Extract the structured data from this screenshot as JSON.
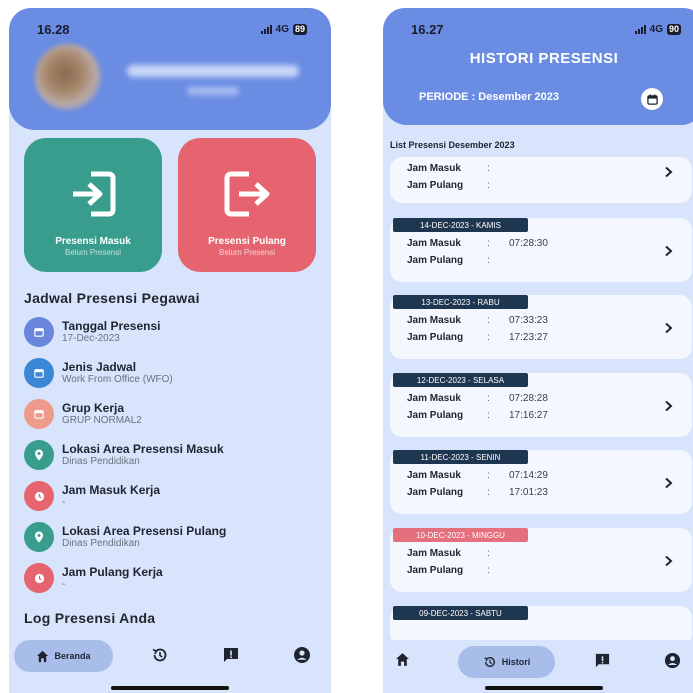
{
  "left": {
    "status": {
      "time": "16.28",
      "network": "4G",
      "battery": "89"
    },
    "tiles": [
      {
        "title": "Presensi Masuk",
        "subtitle": "Belum Presensi",
        "color": "#399d8e"
      },
      {
        "title": "Presensi Pulang",
        "subtitle": "Belum Presensi",
        "color": "#e6646f"
      }
    ],
    "schedule_title": "Jadwal Presensi Pegawai",
    "schedule": [
      {
        "title": "Tanggal Presensi",
        "value": "17-Dec-2023",
        "icon": "calendar-icon",
        "color": "#6a85dc"
      },
      {
        "title": "Jenis Jadwal",
        "value": "Work From Office (WFO)",
        "icon": "calendar-icon",
        "color": "#3b87d6"
      },
      {
        "title": "Grup Kerja",
        "value": "GRUP NORMAL2",
        "icon": "calendar-icon",
        "color": "#ef9b8b"
      },
      {
        "title": "Lokasi Area Presensi Masuk",
        "value": "Dinas Pendidikan",
        "icon": "location-pin-icon",
        "color": "#399d8e"
      },
      {
        "title": "Jam Masuk Kerja",
        "value": "-",
        "icon": "clock-icon",
        "color": "#e6646f"
      },
      {
        "title": "Lokasi Area Presensi Pulang",
        "value": "Dinas Pendidikan",
        "icon": "location-pin-icon",
        "color": "#399d8e"
      },
      {
        "title": "Jam Pulang Kerja",
        "value": "-",
        "icon": "clock-icon",
        "color": "#e6646f"
      }
    ],
    "log_title": "Log Presensi Anda",
    "nav": {
      "home_label": "Beranda"
    }
  },
  "right": {
    "status": {
      "time": "16.27",
      "network": "4G",
      "battery": "90"
    },
    "title": "HISTORI PRESENSI",
    "period": "PERIODE : Desember 2023",
    "list_title": "List Presensi Desember 2023",
    "labels": {
      "masuk": "Jam Masuk",
      "pulang": "Jam Pulang",
      "colon": ":"
    },
    "records": [
      {
        "date": "",
        "masuk": "",
        "pulang": ""
      },
      {
        "date": "14-DEC-2023 - KAMIS",
        "masuk": "07:28:30",
        "pulang": ""
      },
      {
        "date": "13-DEC-2023 - RABU",
        "masuk": "07:33:23",
        "pulang": "17:23:27"
      },
      {
        "date": "12-DEC-2023 - SELASA",
        "masuk": "07:28:28",
        "pulang": "17:16:27"
      },
      {
        "date": "11-DEC-2023 - SENIN",
        "masuk": "07:14:29",
        "pulang": "17:01:23"
      },
      {
        "date": "10-DEC-2023 - MINGGU",
        "masuk": "",
        "pulang": "",
        "holiday": true
      },
      {
        "date": "09-DEC-2023 - SABTU",
        "masuk": "",
        "pulang": ""
      }
    ],
    "nav": {
      "history_label": "Histori"
    }
  }
}
